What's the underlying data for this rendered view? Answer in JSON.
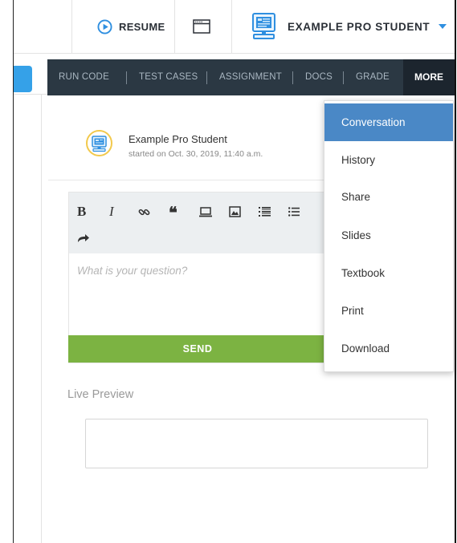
{
  "topbar": {
    "resume_label": "RESUME",
    "user_name": "EXAMPLE PRO STUDENT"
  },
  "nav": {
    "items": [
      "RUN CODE",
      "TEST CASES",
      "ASSIGNMENT",
      "DOCS",
      "GRADE"
    ],
    "more_label": "MORE"
  },
  "conversation": {
    "author": "Example Pro Student",
    "started": "started on Oct. 30, 2019, 11:40 a.m."
  },
  "editor": {
    "placeholder": "What is your question?",
    "send_label": "SEND"
  },
  "preview": {
    "label": "Live Preview"
  },
  "dropdown": {
    "items": [
      "Conversation",
      "History",
      "Share",
      "Slides",
      "Textbook",
      "Print",
      "Download"
    ],
    "active": "Conversation"
  },
  "colors": {
    "nav_bg": "#2b3843",
    "accent_blue": "#2f8fe0",
    "dropdown_active": "#4a88c6",
    "send_green": "#7cb342"
  }
}
